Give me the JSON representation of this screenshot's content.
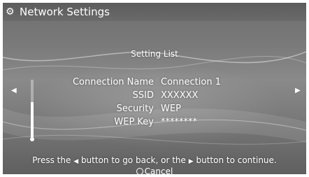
{
  "header": {
    "icon": "network-globe-icon",
    "title": "Network Settings"
  },
  "list": {
    "title": "Setting List",
    "rows": [
      {
        "label": "Connection Name",
        "value": "Connection 1"
      },
      {
        "label": "SSID",
        "value": "XXXXXX"
      },
      {
        "label": "Security",
        "value": "WEP"
      },
      {
        "label": "WEP Key",
        "value": "********"
      }
    ]
  },
  "hint": {
    "part1": "Press the",
    "part2": "button to go back, or the",
    "part3": "button to continue."
  },
  "cancel": {
    "label": "Cancel"
  },
  "colors": {
    "text": "#ffffff",
    "background": "#7a7a7a"
  }
}
